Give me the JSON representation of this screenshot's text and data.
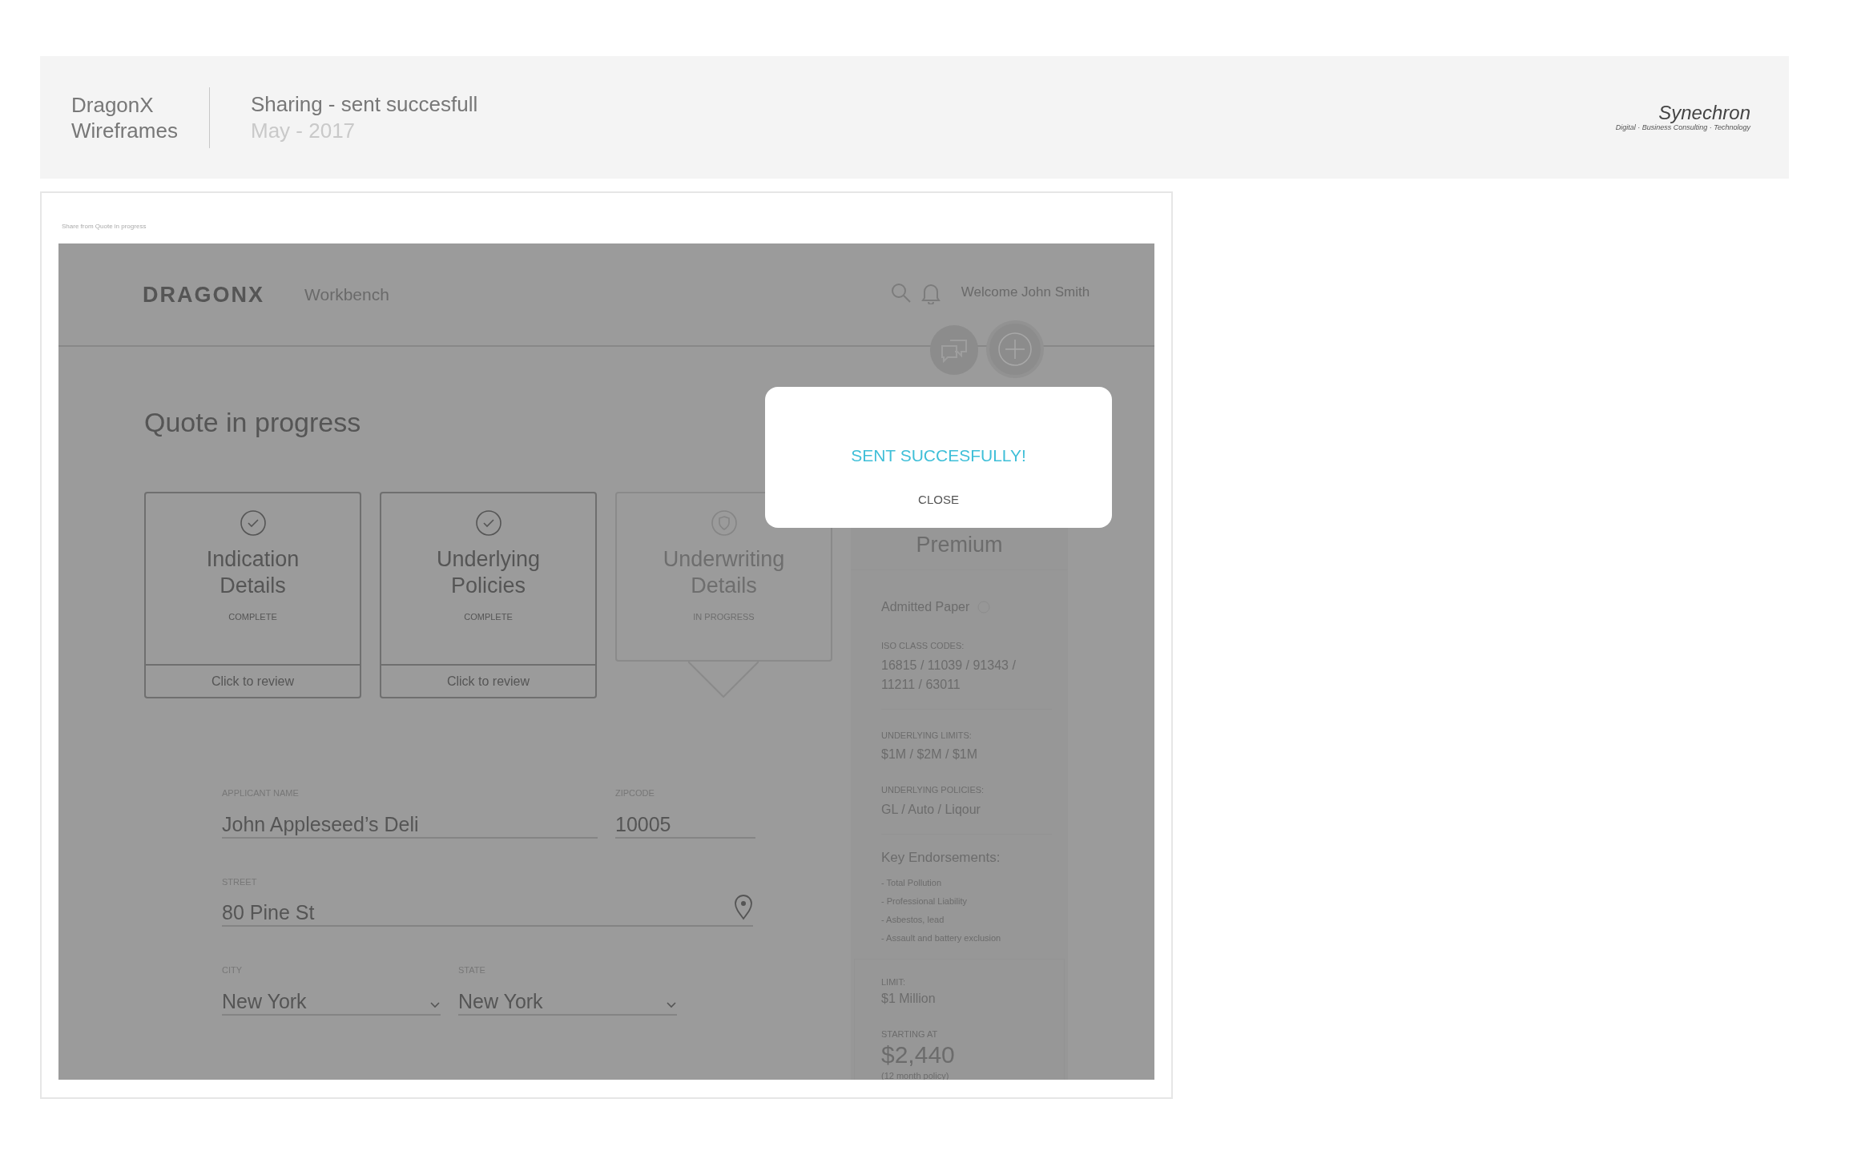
{
  "header": {
    "project": "DragonX",
    "subtitle": "Wireframes",
    "title": "Sharing - sent succesfull",
    "date": "May - 2017",
    "logo": {
      "name": "Synechron",
      "tagline": "Digital · Business Consulting · Technology"
    }
  },
  "artboard": {
    "caption": "Share from Quote in progress"
  },
  "app": {
    "brand": "DRAGONX",
    "nav": "Workbench",
    "welcome": "Welcome John Smith"
  },
  "page_title": "Quote in progress",
  "steps": [
    {
      "kind": "complete",
      "title": "Indication Details",
      "status": "COMPLETE",
      "action": "Click to review"
    },
    {
      "kind": "complete",
      "title": "Underlying Policies",
      "status": "COMPLETE",
      "action": "Click to review"
    },
    {
      "kind": "current",
      "title": "Underwriting Details",
      "status": "IN PROGRESS"
    }
  ],
  "premium": {
    "title": "Premium",
    "paper": "Admitted Paper",
    "sections": [
      {
        "label": "ISO CLASS CODES:",
        "value": "16815 / 11039 / 91343 / 11211 / 63011"
      },
      {
        "label": "UNDERLYING LIMITS:",
        "value": "$1M / $2M / $1M"
      },
      {
        "label": "UNDERLYING POLICIES:",
        "value": "GL / Auto / Liqour"
      }
    ],
    "endorsements_title": "Key Endorsements:",
    "endorsements": [
      "- Total Pollution",
      "- Professional Liability",
      "- Asbestos, lead",
      "- Assault and battery exclusion"
    ],
    "limit_label": "LIMIT:",
    "limit": "$1 Million",
    "starting_label": "STARTING AT",
    "price": "$2,440",
    "price_note": "(12 month policy)"
  },
  "form": {
    "rows": [
      [
        {
          "kind": "text",
          "label": "APPLICANT NAME",
          "value": "John Appleseed’s Deli"
        },
        {
          "kind": "text",
          "label": "ZIPCODE",
          "value": "10005"
        }
      ],
      [
        {
          "kind": "location",
          "label": "STREET",
          "value": "80 Pine St"
        }
      ],
      [
        {
          "kind": "select",
          "label": "CITY",
          "value": "New York"
        },
        {
          "kind": "select",
          "label": "STATE",
          "value": "New York"
        }
      ]
    ]
  },
  "modal": {
    "message": "SENT SUCCESFULLY!",
    "action": "CLOSE"
  }
}
